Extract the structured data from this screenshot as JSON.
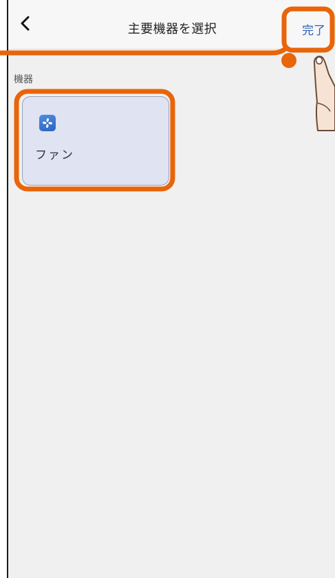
{
  "navbar": {
    "back_icon": "chevron-left-icon",
    "title": "主要機器を選択",
    "done_label": "完了"
  },
  "section": {
    "label": "機器"
  },
  "devices": [
    {
      "label": "ファン",
      "icon": "fan-icon",
      "selected": true
    }
  ],
  "colors": {
    "accent": "#2a5fb0",
    "highlight": "#e8650a",
    "card_background": "#dfe3f2",
    "screen_background": "#f0f0f0"
  }
}
